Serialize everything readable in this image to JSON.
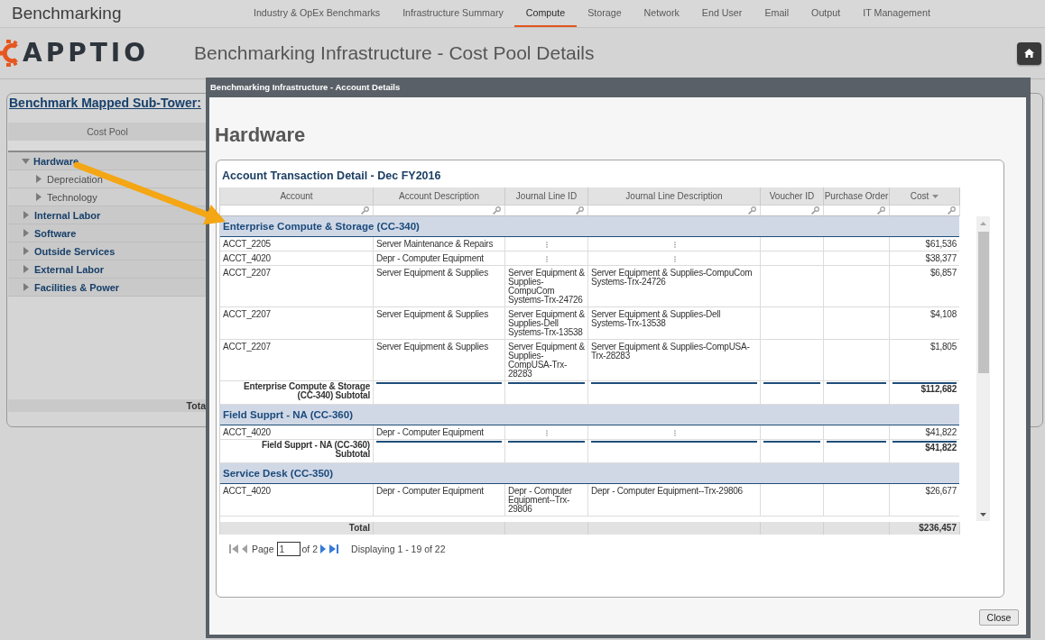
{
  "app": {
    "title": "Benchmarking"
  },
  "nav": [
    {
      "label": "Industry & OpEx Benchmarks",
      "selected": false
    },
    {
      "label": "Infrastructure Summary",
      "selected": false
    },
    {
      "label": "Compute",
      "selected": true
    },
    {
      "label": "Storage",
      "selected": false
    },
    {
      "label": "Network",
      "selected": false
    },
    {
      "label": "End User",
      "selected": false
    },
    {
      "label": "Email",
      "selected": false
    },
    {
      "label": "Output",
      "selected": false
    },
    {
      "label": "IT Management",
      "selected": false
    }
  ],
  "header": {
    "logo": "APPTIO",
    "title": "Benchmarking Infrastructure - Cost Pool Details"
  },
  "panel": {
    "title": "Benchmark Mapped Sub-Tower:",
    "column": "Cost Pool",
    "items": [
      {
        "label": "Hardware",
        "expanded": true,
        "children": [
          {
            "label": "Depreciation",
            "expanded": false
          },
          {
            "label": "Technology",
            "expanded": false
          }
        ]
      },
      {
        "label": "Internal Labor",
        "expanded": false
      },
      {
        "label": "Software",
        "expanded": false
      },
      {
        "label": "Outside Services",
        "expanded": false
      },
      {
        "label": "External Labor",
        "expanded": false
      },
      {
        "label": "Facilities & Power",
        "expanded": false
      }
    ],
    "total_label": "Tota"
  },
  "modal": {
    "title": "Benchmarking Infrastructure - Account Details",
    "heading": "Hardware",
    "grid": {
      "title": "Account Transaction Detail - Dec FY2016",
      "columns": [
        {
          "label": "Account",
          "sorted": false
        },
        {
          "label": "Account Description",
          "sorted": false
        },
        {
          "label": "Journal Line ID",
          "sorted": false
        },
        {
          "label": "Journal Line Description",
          "sorted": false
        },
        {
          "label": "Voucher ID",
          "sorted": false
        },
        {
          "label": "Purchase Order",
          "sorted": false
        },
        {
          "label": "Cost",
          "sorted": true
        }
      ],
      "groups": [
        {
          "name": "Enterprise Compute & Storage (CC-340)",
          "rows": [
            {
              "account": "ACCT_2205",
              "account_description": "Server Maintenance & Repairs",
              "cost": "$61,536"
            },
            {
              "account": "ACCT_4020",
              "account_description": "Depr - Computer Equipment",
              "cost": "$38,377"
            },
            {
              "account": "ACCT_2207",
              "account_description": "Server Equipment & Supplies",
              "journal_line_id": "Server Equipment & Supplies-CompuCom Systems-Trx-24726",
              "journal_line_description": "Server Equipment & Supplies-CompuCom Systems-Trx-24726",
              "cost": "$6,857"
            },
            {
              "account": "ACCT_2207",
              "account_description": "Server Equipment & Supplies",
              "journal_line_id": "Server Equipment & Supplies-Dell Systems-Trx-13538",
              "journal_line_description": "Server Equipment & Supplies-Dell Systems-Trx-13538",
              "cost": "$4,108"
            },
            {
              "account": "ACCT_2207",
              "account_description": "Server Equipment & Supplies",
              "journal_line_id": "Server Equipment & Supplies-CompUSA-Trx-28283",
              "journal_line_description": "Server Equipment & Supplies-CompUSA-Trx-28283",
              "cost": "$1,805"
            }
          ],
          "subtotal_label": "Enterprise Compute & Storage (CC-340) Subtotal",
          "subtotal": "$112,682"
        },
        {
          "name": "Field Supprt - NA (CC-360)",
          "rows": [
            {
              "account": "ACCT_4020",
              "account_description": "Depr - Computer Equipment",
              "cost": "$41,822"
            }
          ],
          "subtotal_label": "Field Supprt - NA (CC-360) Subtotal",
          "subtotal": "$41,822"
        },
        {
          "name": "Service Desk (CC-350)",
          "rows": [
            {
              "account": "ACCT_4020",
              "account_description": "Depr - Computer Equipment",
              "journal_line_id": "Depr - Computer Equipment--Trx-29806",
              "journal_line_description": "Depr - Computer Equipment--Trx-29806",
              "cost": "$26,677"
            }
          ]
        }
      ],
      "total_label": "Total",
      "total": "$236,457"
    },
    "pager": {
      "first": {
        "disabled": true
      },
      "prev": {
        "disabled": true
      },
      "page_label": "Page",
      "page": "1",
      "page_count": "of 2",
      "next": {
        "disabled": false
      },
      "last": {
        "disabled": false
      },
      "status": "Displaying 1 - 19 of 22"
    },
    "buttons": [
      "Close"
    ]
  }
}
